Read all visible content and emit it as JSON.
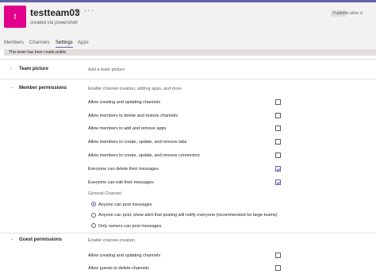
{
  "header": {
    "avatar_letter": "t",
    "team_name": "testteam03",
    "star_glyph": "★",
    "more_glyph": "···",
    "subtitle": "created via powershell",
    "badge_public": "Public",
    "badge_more": "No other cl"
  },
  "tabs": [
    {
      "label": "Members",
      "active": false
    },
    {
      "label": "Channels",
      "active": false
    },
    {
      "label": "Settings",
      "active": true
    },
    {
      "label": "Apps",
      "active": false
    }
  ],
  "notice": "This team has been made public.",
  "sections": {
    "team_picture": {
      "chevron": "›",
      "label": "Team picture",
      "desc": "Add a team picture"
    },
    "member_permissions": {
      "chevron": "⌄",
      "label": "Member permissions",
      "desc": "Enable channel creation, adding apps, and more",
      "items": [
        {
          "label": "Allow creating and updating channels",
          "checked": false
        },
        {
          "label": "Allow members to delete and restore channels",
          "checked": false
        },
        {
          "label": "Allow members to add and remove apps",
          "checked": false
        },
        {
          "label": "Allow members to create, update, and remove tabs",
          "checked": false
        },
        {
          "label": "Allow members to create, update, and remove connectors",
          "checked": false
        },
        {
          "label": "Everyone can delete their messages",
          "checked": true
        },
        {
          "label": "Everyone can edit their messages",
          "checked": true
        }
      ],
      "general_channel_heading": "General Channel:",
      "radios": [
        {
          "label": "Anyone can post messages",
          "selected": true
        },
        {
          "label": "Anyone can post; show alert that posting will notify everyone (recommended for large teams)",
          "selected": false
        },
        {
          "label": "Only owners can post messages",
          "selected": false
        }
      ]
    },
    "guest_permissions": {
      "chevron": "⌄",
      "label": "Guest permissions",
      "desc": "Enable channel creation",
      "items": [
        {
          "label": "Allow creating and updating channels",
          "checked": false
        },
        {
          "label": "Allow guests to delete channels",
          "checked": false
        }
      ]
    }
  },
  "colors": {
    "accent": "#6264a7",
    "avatar": "#e3008c",
    "header_bg": "#f3f2f1"
  }
}
